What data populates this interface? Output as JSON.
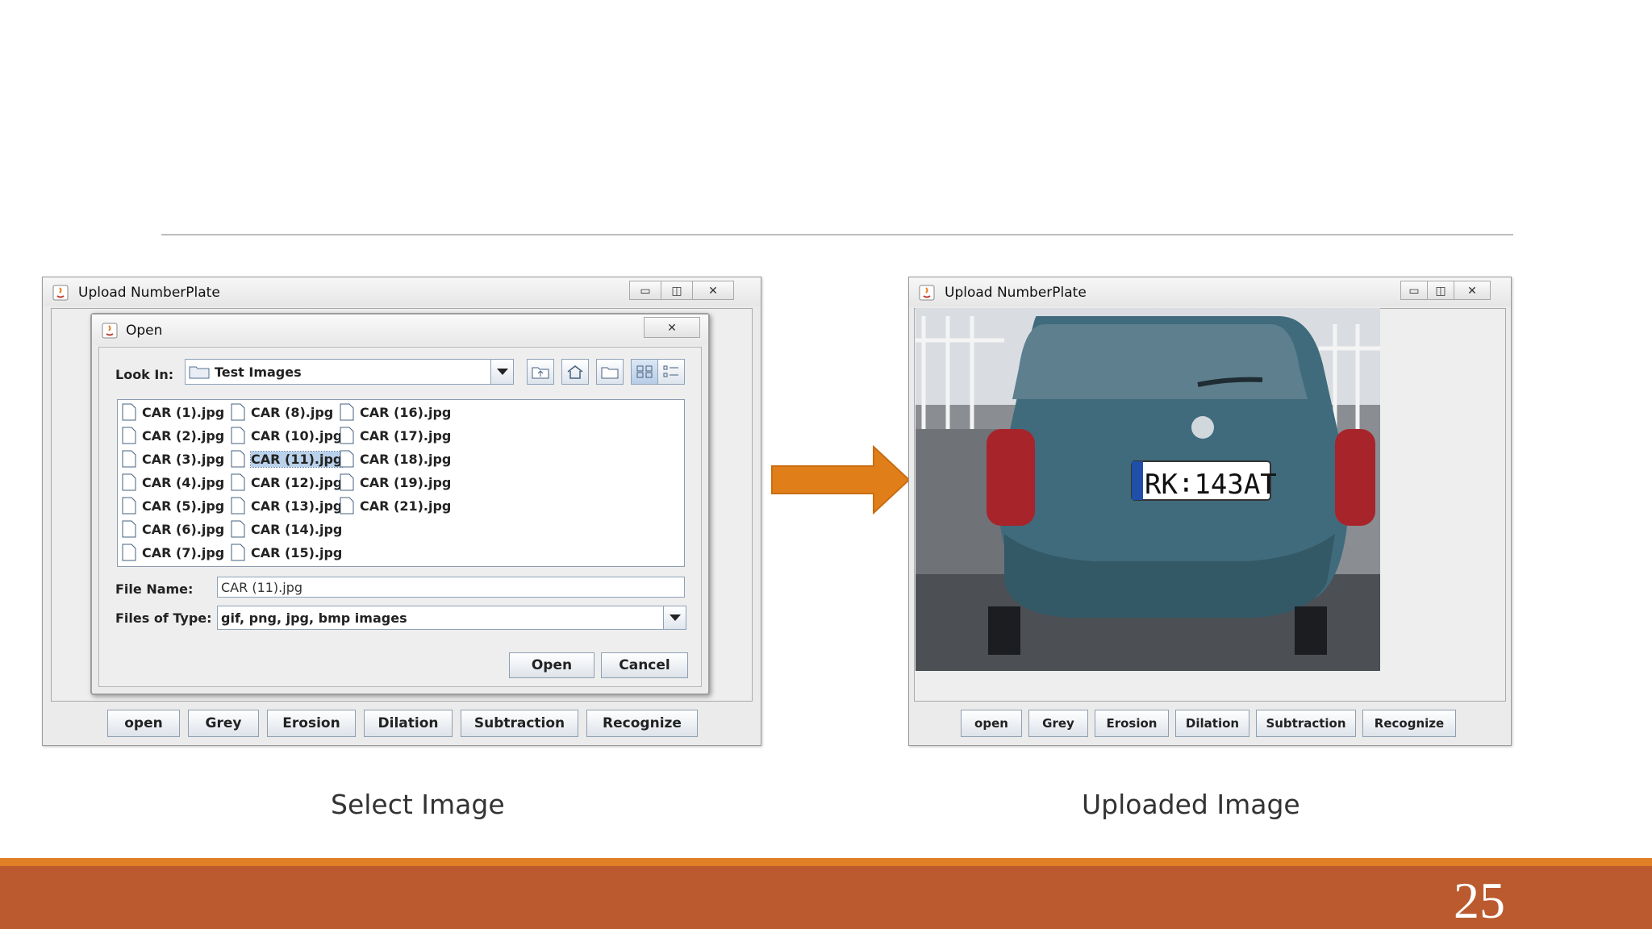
{
  "app_title": "Upload NumberPlate",
  "window_controls": {
    "minimize": "▭",
    "maximize": "◫",
    "close": "✕"
  },
  "toolbar_buttons": [
    "open",
    "Grey",
    "Erosion",
    "Dilation",
    "Subtraction",
    "Recognize"
  ],
  "open_dialog": {
    "title": "Open",
    "look_in_label": "Look In:",
    "look_in_value": "Test Images",
    "files": [
      "CAR (1).jpg",
      "CAR (2).jpg",
      "CAR (3).jpg",
      "CAR (4).jpg",
      "CAR (5).jpg",
      "CAR (6).jpg",
      "CAR (7).jpg",
      "CAR (8).jpg",
      "CAR (10).jpg",
      "CAR (11).jpg",
      "CAR (12).jpg",
      "CAR (13).jpg",
      "CAR (14).jpg",
      "CAR (15).jpg",
      "CAR (16).jpg",
      "CAR (17).jpg",
      "CAR (18).jpg",
      "CAR (19).jpg",
      "CAR (21).jpg"
    ],
    "selected_file": "CAR (11).jpg",
    "file_name_label": "File Name:",
    "file_name_value": "CAR (11).jpg",
    "file_type_label": "Files of Type:",
    "file_type_value": "gif, png, jpg, bmp images",
    "open_button": "Open",
    "cancel_button": "Cancel"
  },
  "plate_text": "RK∶143AT",
  "captions": {
    "left": "Select Image",
    "right": "Uploaded Image"
  },
  "page_number": "25",
  "colors": {
    "arrow": "#e07f1a",
    "footer": "#bb5a2e",
    "footer_accent": "#e07f25",
    "selection": "#b9d1ea"
  }
}
